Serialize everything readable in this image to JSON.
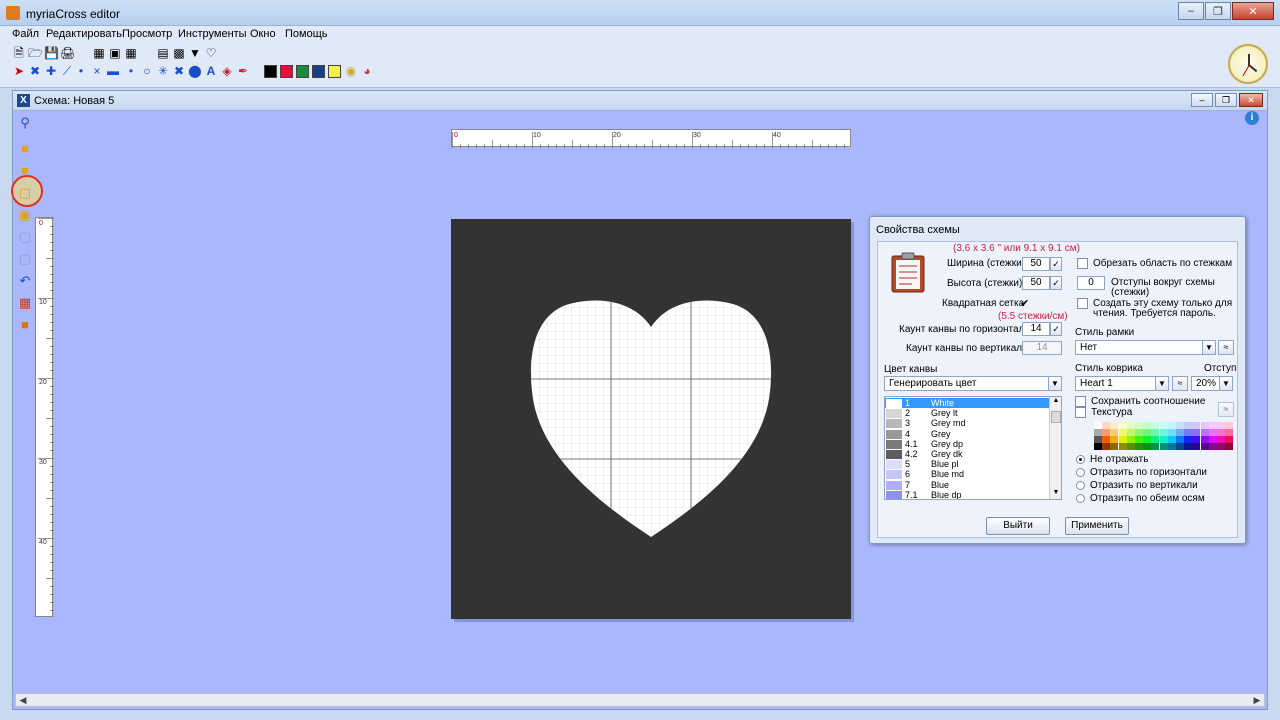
{
  "app": {
    "title": "myriaCross editor"
  },
  "window_buttons": {
    "minimize": "‒",
    "restore": "❐",
    "close": "✕"
  },
  "menu": [
    "Файл",
    "Редактировать",
    "Просмотр",
    "Инструменты",
    "Окно",
    "Помощь"
  ],
  "toolbar": {
    "colors": [
      "#000000",
      "#e0103a",
      "#1a8a3a",
      "#1a3f8a",
      "#f4f04a",
      "#f6e58a",
      "#e8403a"
    ]
  },
  "document": {
    "title": "Схема: Новая 5",
    "icon": "X",
    "info_icon": "i",
    "ruler_top_labels": [
      "0",
      "10",
      "20",
      "30",
      "40"
    ],
    "ruler_left_labels": [
      "0",
      "10",
      "20",
      "30",
      "40"
    ]
  },
  "dialog": {
    "title": "Свойства схемы",
    "size_note": "(3.6 x 3.6 \" или 9.1 x 9.1 см)",
    "width_label": "Ширина (стежки)",
    "width_value": "50",
    "height_label": "Высота (стежки)",
    "height_value": "50",
    "square_grid_label": "Квадратная сетка",
    "square_grid_checked": "✔",
    "count_note": "(5.5 стежки/см)",
    "count_h_label": "Каунт канвы по горизонтали",
    "count_h_value": "14",
    "count_v_label": "Каунт канвы по вертикали",
    "count_v_value": "14",
    "trim_label": "Обрезать область по стежкам",
    "margin_value": "0",
    "margin_label_1": "Отступы вокруг схемы",
    "margin_label_2": "(стежки)",
    "readonly_label_1": "Создать эту схему только для",
    "readonly_label_2": "чтения. Требуется пароль.",
    "frame_style_label": "Стиль рамки",
    "frame_style_value": "Нет",
    "canvas_color_label": "Цвет канвы",
    "canvas_color_value": "Генерировать цвет",
    "mat_style_label": "Стиль коврика",
    "indent_label": "Отступ",
    "mat_style_value": "Heart 1",
    "indent_value": "20%",
    "keep_ratio_label": "Сохранить соотношение",
    "texture_label": "Текстура",
    "mirror_none": "Не отражать",
    "mirror_h": "Отразить по горизонтали",
    "mirror_v": "Отразить по вертикали",
    "mirror_both": "Отразить по обеим осям",
    "exit_button": "Выйти",
    "apply_button": "Применить",
    "check_mark": "✓",
    "floss": [
      {
        "num": "1",
        "name": "White",
        "color": "#ffffff"
      },
      {
        "num": "2",
        "name": "Grey lt",
        "color": "#d6d6d6"
      },
      {
        "num": "3",
        "name": "Grey md",
        "color": "#b8b8b8"
      },
      {
        "num": "4",
        "name": "Grey",
        "color": "#999999"
      },
      {
        "num": "4.1",
        "name": "Grey dp",
        "color": "#7a7a7a"
      },
      {
        "num": "4.2",
        "name": "Grey dk",
        "color": "#5c5c5c"
      },
      {
        "num": "5",
        "name": "Blue pl",
        "color": "#dcdcfc"
      },
      {
        "num": "6",
        "name": "Blue md",
        "color": "#c4c6fb"
      },
      {
        "num": "7",
        "name": "Blue",
        "color": "#aeb0fb"
      },
      {
        "num": "7.1",
        "name": "Blue dp",
        "color": "#8e90f0"
      }
    ]
  }
}
